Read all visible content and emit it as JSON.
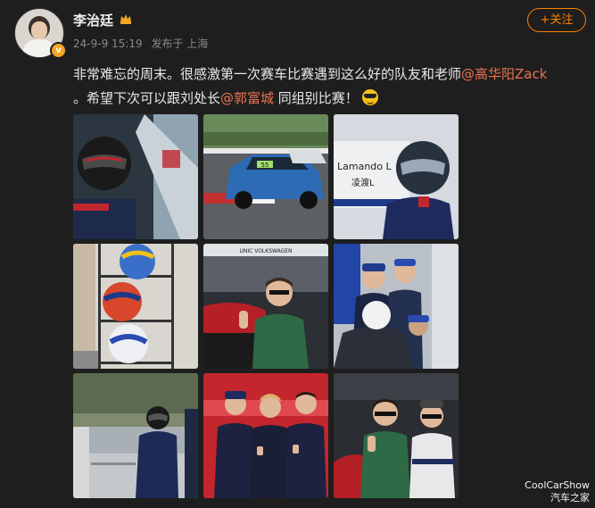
{
  "post": {
    "username": "李治廷",
    "date": "24-9-9 15:19",
    "source": "发布于 上海",
    "follow_label": "+关注",
    "text_part1": "非常难忘的周末。很感激第一次赛车比赛遇到这么好的队友和老师",
    "mention1": "@高华阳Zack",
    "text_part2": "。希望下次可以跟刘处长",
    "mention2": "@郭富城",
    "text_part3": " 同组别比赛！",
    "emoji": "cool-sunglasses-emoji"
  },
  "images": [
    {
      "name": "driver-in-cockpit-photo"
    },
    {
      "name": "race-car-on-track-photo"
    },
    {
      "name": "driver-with-helmet-photo"
    },
    {
      "name": "helmets-on-shelf-photo"
    },
    {
      "name": "man-in-green-jacket-photo"
    },
    {
      "name": "drivers-in-pit-photo"
    },
    {
      "name": "driver-walking-in-suit-photo"
    },
    {
      "name": "team-thumbs-up-photo"
    },
    {
      "name": "two-men-posing-photo"
    }
  ],
  "photo_text": {
    "car_number": "55",
    "banner": "Lamando L",
    "banner_cn": "凌渡L",
    "sponsor": "UNIC VOLKSWAGEN"
  },
  "watermark": {
    "line1": "CoolCarShow",
    "line2": "汽车之家"
  },
  "colors": {
    "background": "#1e1e1e",
    "mention": "#eb7350",
    "follow": "#ff8200",
    "verified_badge": "#f5a623"
  }
}
